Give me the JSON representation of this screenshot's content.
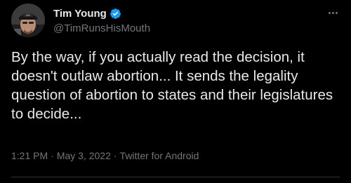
{
  "author": {
    "display_name": "Tim Young",
    "handle": "@TimRunsHisMouth",
    "verified": true,
    "verified_badge_icon": "verified-badge-icon",
    "avatar_icon": "avatar-photo"
  },
  "tweet": {
    "text": "By the way, if you actually read the decision, it doesn't outlaw abortion... It sends the legality question of abortion to states and their legislatures to decide..."
  },
  "meta": {
    "time": "1:21 PM",
    "date": "May 3, 2022",
    "source": "Twitter for Android",
    "separator": "·"
  },
  "more_menu_icon": "more-horizontal-icon",
  "colors": {
    "background": "#000000",
    "text_primary": "#e7e9ea",
    "text_secondary": "#71767b",
    "verified": "#1d9bf0"
  }
}
